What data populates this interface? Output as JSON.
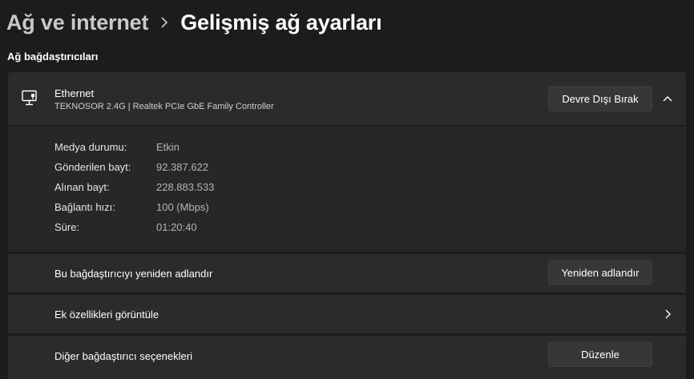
{
  "breadcrumb": {
    "parent": "Ağ ve internet",
    "current": "Gelişmiş ağ ayarları"
  },
  "section": {
    "title": "Ağ bağdaştırıcıları"
  },
  "adapter": {
    "name": "Ethernet",
    "description": "TEKNOSOR 2.4G | Realtek PCIe GbE Family Controller",
    "disable_button": "Devre Dışı Bırak",
    "icon": "ethernet-monitor-icon",
    "details": [
      {
        "label": "Medya durumu:",
        "value": "Etkin"
      },
      {
        "label": "Gönderilen bayt:",
        "value": "92.387.622"
      },
      {
        "label": "Alınan bayt:",
        "value": "228.883.533"
      },
      {
        "label": "Bağlantı hızı:",
        "value": "100 (Mbps)"
      },
      {
        "label": "Süre:",
        "value": "01:20:40"
      }
    ]
  },
  "rows": {
    "rename": {
      "label": "Bu bağdaştırıcıyı yeniden adlandır",
      "button": "Yeniden adlandır"
    },
    "properties": {
      "label": "Ek özellikleri görüntüle"
    },
    "more_options": {
      "label": "Diğer bağdaştırıcı seçenekleri",
      "button": "Düzenle"
    }
  },
  "colors": {
    "background": "#1c1c1c",
    "card": "#2b2b2b",
    "button": "#373737"
  }
}
